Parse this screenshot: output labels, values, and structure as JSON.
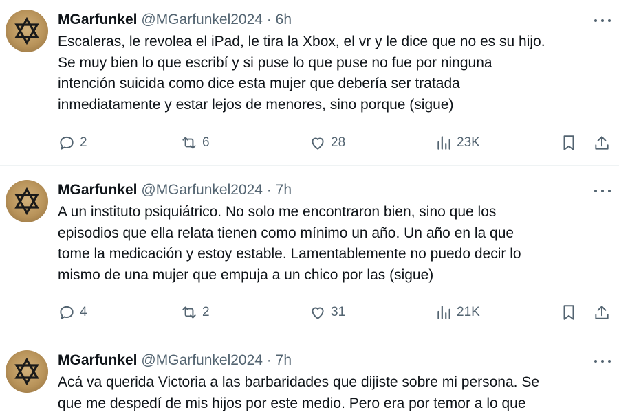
{
  "tweets": [
    {
      "name": "MGarfunkel",
      "handle": "@MGarfunkel2024",
      "separator": "·",
      "time": "6h",
      "lines": [
        "Escaleras, le revolea el iPad, le tira la Xbox, el vr y le dice que no es su hijo.",
        "Se muy bien lo que escribí y si puse lo que puse no fue por ninguna",
        "intención suicida como dice esta mujer que debería ser tratada",
        "inmediatamente y estar lejos de menores, sino porque (sigue)"
      ],
      "stats": {
        "replies": "2",
        "reposts": "6",
        "likes": "28",
        "views": "23K"
      }
    },
    {
      "name": "MGarfunkel",
      "handle": "@MGarfunkel2024",
      "separator": "·",
      "time": "7h",
      "lines": [
        "A un instituto psiquiátrico. No solo me encontraron bien, sino que los",
        "episodios que ella relata tienen como mínimo un año. Un año en la que",
        "tome la medicación y estoy estable. Lamentablemente no puedo decir lo",
        "mismo de una mujer que empuja a un chico por las (sigue)"
      ],
      "stats": {
        "replies": "4",
        "reposts": "2",
        "likes": "31",
        "views": "21K"
      }
    },
    {
      "name": "MGarfunkel",
      "handle": "@MGarfunkel2024",
      "separator": "·",
      "time": "7h",
      "lines": [
        "Acá va querida Victoria a las barbaridades que dijiste sobre mi persona. Se",
        "que me despedí de mis hijos por este medio. Pero era por temor a lo que"
      ],
      "stats": null
    }
  ],
  "icons": {
    "avatar": "star-of-david-icon",
    "more": "more-horizontal-icon",
    "reply": "reply-icon",
    "repost": "repost-icon",
    "like": "heart-icon",
    "views": "views-chart-icon",
    "bookmark": "bookmark-icon",
    "share": "share-icon"
  },
  "colors": {
    "text": "#0f1419",
    "secondary": "#536471",
    "divider": "#eff3f4",
    "avatar": "#b8935a"
  }
}
